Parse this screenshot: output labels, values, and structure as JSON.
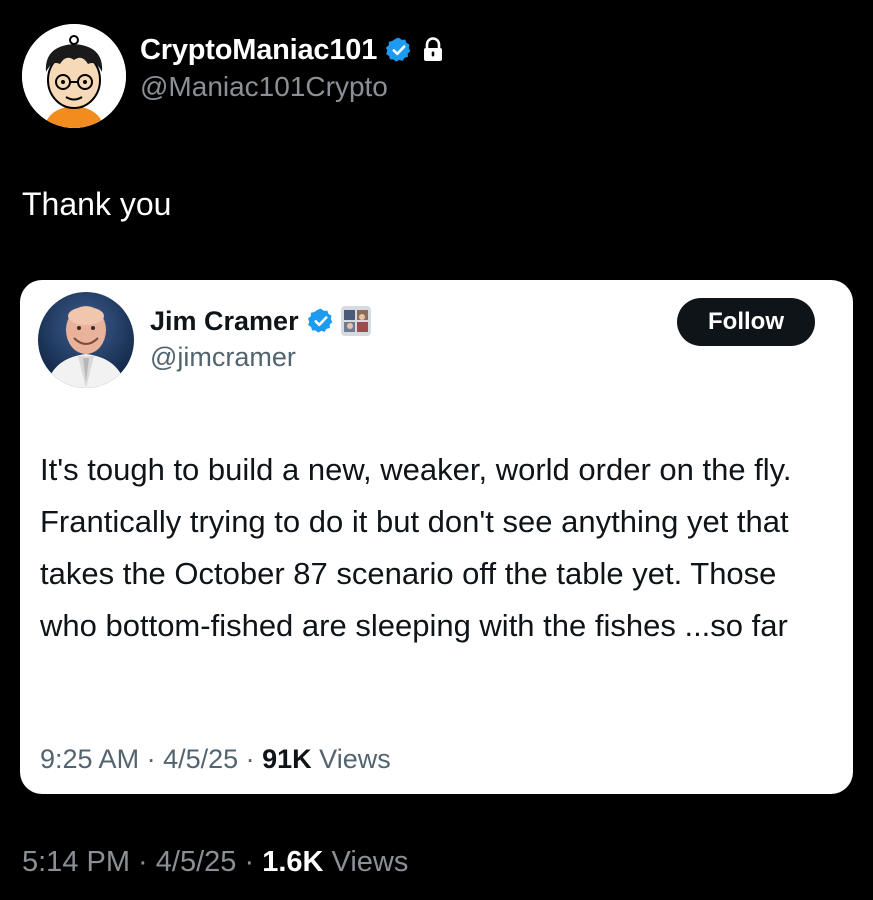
{
  "post": {
    "author": {
      "display_name": "CryptoManiac101",
      "handle": "@Maniac101Crypto",
      "verified_icon": "verified-badge-icon",
      "protected_icon": "lock-icon"
    },
    "text": "Thank you",
    "meta": {
      "time": "5:14 PM",
      "sep1": " · ",
      "date": "4/5/25",
      "sep2": " · ",
      "views_count": "1.6K",
      "views_label": " Views"
    }
  },
  "quoted_post": {
    "author": {
      "display_name": "Jim Cramer",
      "handle": "@jimcramer",
      "verified_icon": "verified-badge-icon",
      "affiliate_icon": "affiliate-badge-icon"
    },
    "follow_label": "Follow",
    "text": "It's tough to build a new, weaker, world order on the fly. Frantically trying to do it but don't see anything yet that takes the October 87 scenario off the table yet. Those who bottom-fished are sleeping with the fishes ...so far",
    "meta": {
      "time": "9:25 AM",
      "sep1": " · ",
      "date": "4/5/25",
      "sep2": " · ",
      "views_count": "91K",
      "views_label": " Views"
    }
  },
  "colors": {
    "background": "#000000",
    "verified_blue": "#1d9bf0",
    "secondary_dark": "#8b9097",
    "secondary_light": "#536471",
    "text_dark": "#0f1419"
  }
}
